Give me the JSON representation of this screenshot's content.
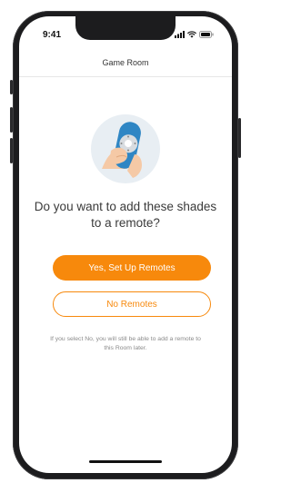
{
  "status_bar": {
    "time": "9:41",
    "icons": [
      "signal-icon",
      "wifi-icon",
      "battery-icon"
    ]
  },
  "header": {
    "title": "Game Room"
  },
  "illustration": {
    "icon": "remote-in-hand-icon"
  },
  "main": {
    "question": "Do you want to add these shades to a remote?",
    "primary_button_label": "Yes, Set Up Remotes",
    "secondary_button_label": "No Remotes",
    "footnote": "If you select No, you will still be able to add a remote to this Room later."
  },
  "colors": {
    "accent": "#f7890c",
    "remote_blue": "#2f86c4",
    "illustration_bg": "#e8eef3",
    "skin": "#f5c9a6"
  }
}
